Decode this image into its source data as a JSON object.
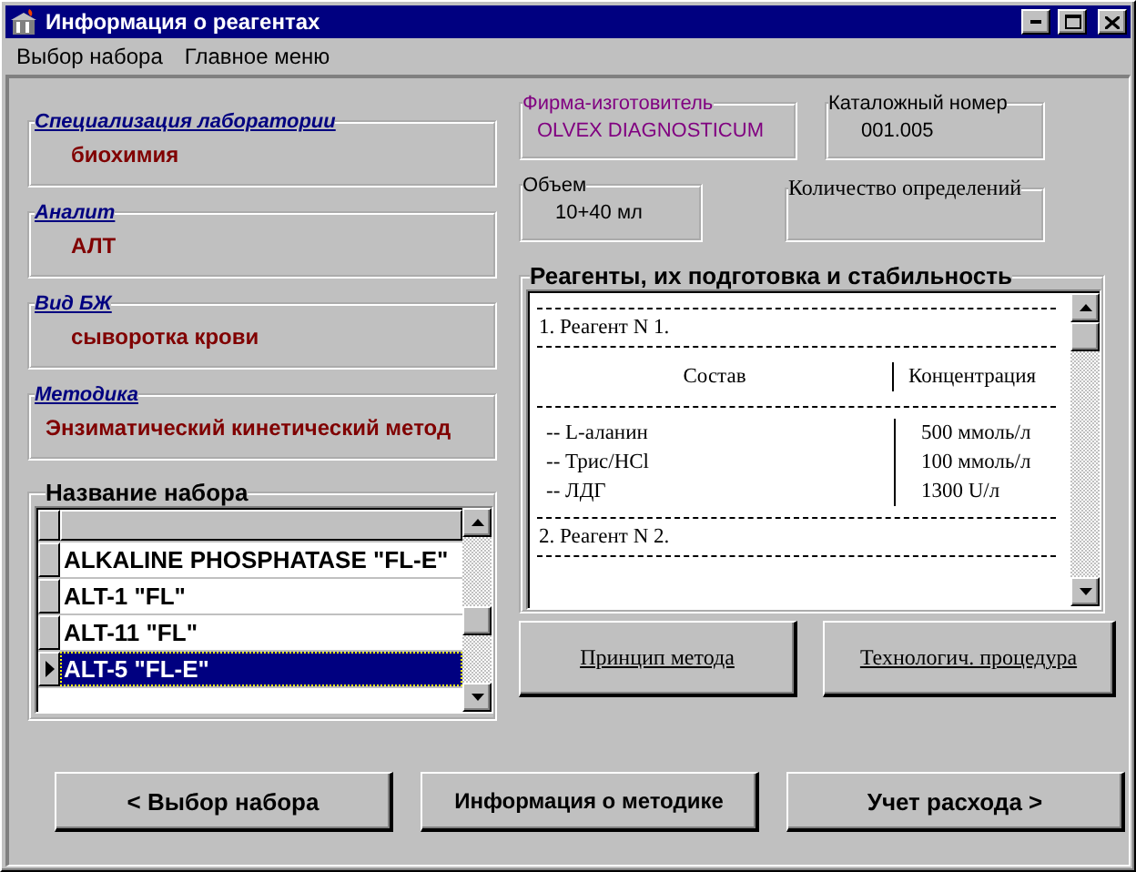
{
  "window": {
    "title": "Информация о реагентах"
  },
  "menu": [
    "Выбор набора",
    "Главное меню"
  ],
  "fields": [
    {
      "label": "Специализация лаборатории",
      "value": "биохимия"
    },
    {
      "label": "Аналит",
      "value": "АЛТ"
    },
    {
      "label": "Вид БЖ",
      "value": "сыворотка крови"
    },
    {
      "label": "Методика",
      "value": "Энзиматический кинетический метод"
    }
  ],
  "kit_list": {
    "title": "Название набора",
    "rows": [
      {
        "name": "ALKALINE PHOSPHATASE \"FL-E\"",
        "selected": false
      },
      {
        "name": "ALT-1 \"FL\"",
        "selected": false
      },
      {
        "name": "ALT-11 \"FL\"",
        "selected": false
      },
      {
        "name": "ALT-5 \"FL-E\"",
        "selected": true
      }
    ]
  },
  "info_fields": [
    {
      "label": "Фирма-изготовитель",
      "value": "OLVEX DIAGNOSTICUM",
      "kind": "vendor"
    },
    {
      "label": "Каталожный номер",
      "value": "001.005",
      "kind": "plain"
    },
    {
      "label": "Объем",
      "value": "10+40 мл",
      "kind": "plain"
    },
    {
      "label": "Количество определений",
      "kind": "serif"
    }
  ],
  "reagents": {
    "title": "Реагенты, их подготовка и стабильность",
    "sections": [
      {
        "title": "1. Реагент N 1.",
        "header": [
          "Состав",
          "Концентрация"
        ],
        "components": [
          {
            "name": "-- L-аланин",
            "concentration": "500 ммоль/л"
          },
          {
            "name": "-- Трис/HCl",
            "concentration": "100 ммоль/л"
          },
          {
            "name": "--  ЛДГ",
            "concentration": "1300 U/л"
          }
        ]
      },
      {
        "title": "2. Реагент N 2."
      }
    ]
  },
  "side_buttons": [
    "Принцип метода",
    "Технологич. процедура"
  ],
  "nav_buttons": [
    {
      "label": "<  Выбор набора"
    },
    {
      "label": "Информация о методике"
    },
    {
      "label": "Учет расхода  >"
    }
  ]
}
